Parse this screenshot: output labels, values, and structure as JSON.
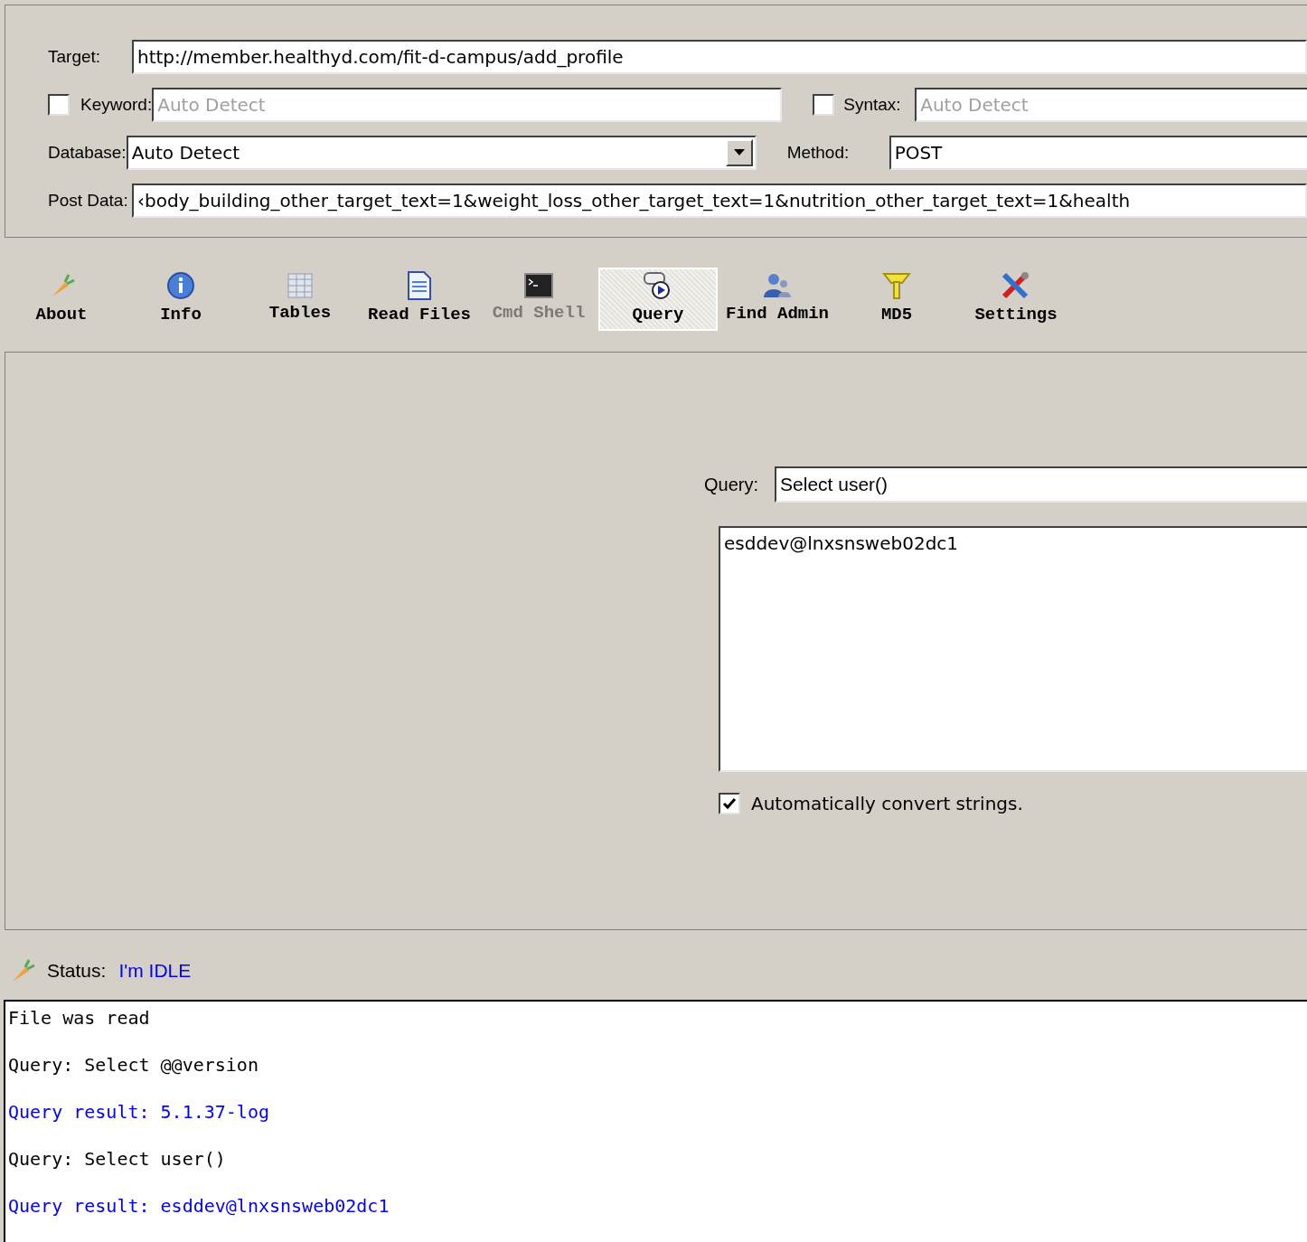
{
  "form": {
    "target": {
      "label": "Target:",
      "value": "http://member.healthyd.com/fit-d-campus/add_profile"
    },
    "keyword": {
      "label": "Keyword:",
      "checked": false,
      "placeholder": "Auto Detect"
    },
    "syntax": {
      "label": "Syntax:",
      "checked": false,
      "placeholder": "Auto Detect"
    },
    "database": {
      "label": "Database:",
      "value": "Auto Detect"
    },
    "method": {
      "label": "Method:",
      "value": "POST"
    },
    "post_data": {
      "label": "Post Data:",
      "value": "‹body_building_other_target_text=1&weight_loss_other_target_text=1&nutrition_other_target_text=1&health"
    }
  },
  "toolbar": [
    {
      "label": "About",
      "selected": false,
      "disabled": false
    },
    {
      "label": "Info",
      "selected": false,
      "disabled": false
    },
    {
      "label": "Tables",
      "selected": false,
      "disabled": false
    },
    {
      "label": "Read Files",
      "selected": false,
      "disabled": false
    },
    {
      "label": "Cmd Shell",
      "selected": false,
      "disabled": true
    },
    {
      "label": "Query",
      "selected": true,
      "disabled": false
    },
    {
      "label": "Find Admin",
      "selected": false,
      "disabled": false
    },
    {
      "label": "MD5",
      "selected": false,
      "disabled": false
    },
    {
      "label": "Settings",
      "selected": false,
      "disabled": false
    }
  ],
  "query_panel": {
    "label": "Query:",
    "value": "Select user()",
    "result": "esddev@lnxsnsweb02dc1",
    "auto_convert": {
      "label": "Automatically convert strings.",
      "checked": true
    }
  },
  "status": {
    "label": "Status:",
    "value": "I'm IDLE"
  },
  "log": [
    {
      "text": "File was read",
      "kind": "message"
    },
    {
      "text": "Query: Select @@version",
      "kind": "message"
    },
    {
      "text": "Query result: 5.1.37-log",
      "kind": "result"
    },
    {
      "text": "Query: Select user()",
      "kind": "message"
    },
    {
      "text": "Query result: esddev@lnxsnsweb02dc1",
      "kind": "result"
    }
  ]
}
